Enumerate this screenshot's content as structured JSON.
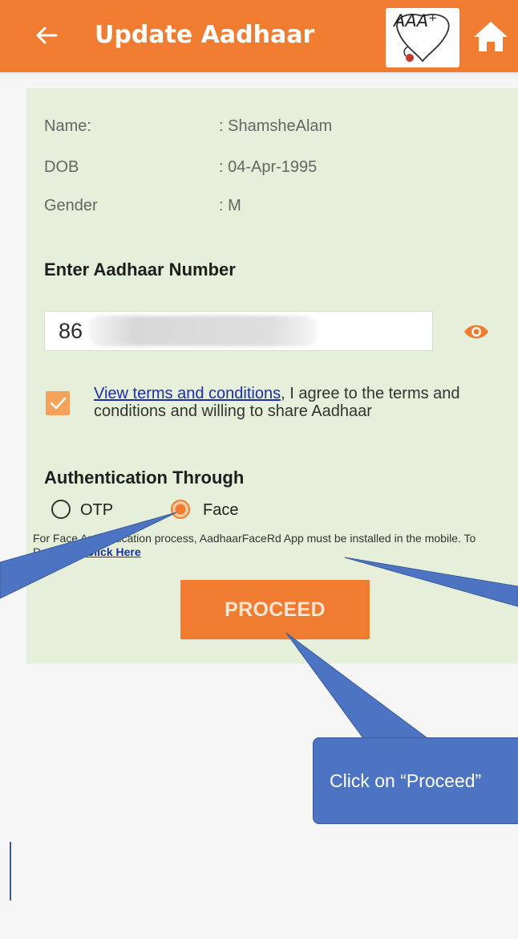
{
  "app_bar": {
    "title": "Update Aadhaar",
    "logo_text": "AAA⁺",
    "color": "#f07c32"
  },
  "details": {
    "name_label": "Name:",
    "name_value": ": ShamsheAlam",
    "dob_label": "DOB",
    "dob_value": ": 04-Apr-1995",
    "gender_label": "Gender",
    "gender_value": ": M"
  },
  "aadhaar": {
    "section_title": "Enter Aadhaar Number",
    "value": "86"
  },
  "terms": {
    "checked": true,
    "link_text": "View terms and conditions",
    "text": ", I agree to the terms and conditions and willing to share Aadhaar"
  },
  "authentication": {
    "section_title": "Authentication Through",
    "options": [
      "OTP",
      "Face"
    ],
    "selected": "Face",
    "note_text": "For Face Authentication process, AadhaarFaceRd App must be installed in the mobile. To Download ",
    "note_link": "Click Here"
  },
  "proceed_label": "PROCEED",
  "callout": {
    "text": "Click on “Proceed”",
    "color": "#4c74c2"
  },
  "icons": [
    "back-arrow-icon",
    "aaa-logo-icon",
    "home-icon",
    "eye-icon",
    "checkmark-icon"
  ]
}
